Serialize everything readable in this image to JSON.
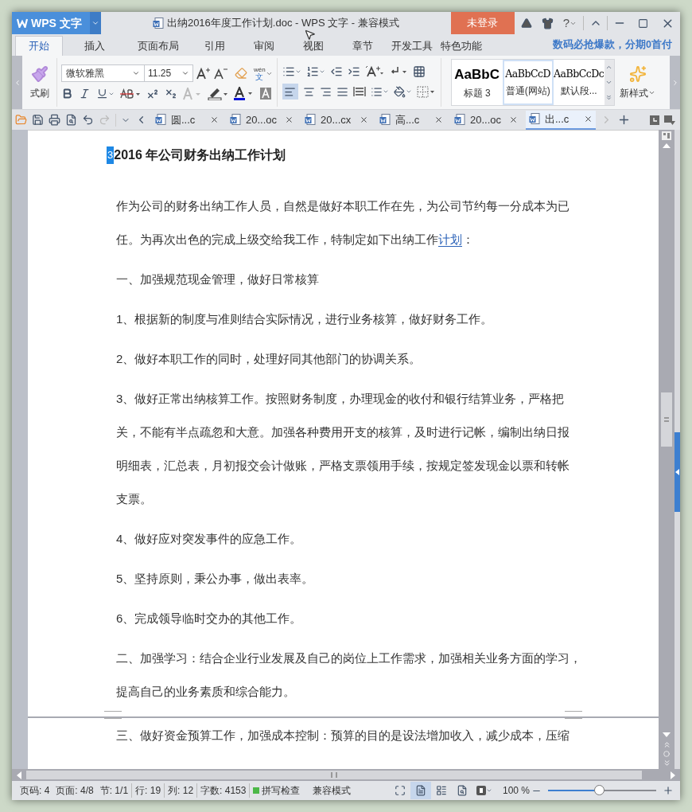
{
  "title_bar": {
    "app_button": "WPS 文字",
    "doc_title": "出纳2016年度工作计划.doc - WPS 文字 - 兼容模式",
    "login": "未登录",
    "help": "?"
  },
  "ribbon_tabs": [
    {
      "label": "开始",
      "selected": true
    },
    {
      "label": "插入",
      "selected": false
    },
    {
      "label": "页面布局",
      "selected": false
    },
    {
      "label": "引用",
      "selected": false
    },
    {
      "label": "审阅",
      "selected": false
    },
    {
      "label": "视图",
      "selected": false
    },
    {
      "label": "章节",
      "selected": false
    },
    {
      "label": "开发工具",
      "selected": false
    },
    {
      "label": "特色功能",
      "selected": false
    }
  ],
  "promo": "数码必抢爆款，分期0首付",
  "ribbon": {
    "format_painter": "式刷",
    "font": "微软雅黑",
    "font_size": "11.25",
    "pinyin": "wén",
    "pinyin_char": "文",
    "styles": [
      {
        "preview": "AaBbC",
        "name": "标题 3",
        "selected": false,
        "kind": "heading"
      },
      {
        "preview": "AaBbCcD",
        "name": "普通(网站)",
        "selected": true,
        "kind": "normal"
      },
      {
        "preview": "AaBbCcDc",
        "name": "默认段...",
        "selected": false,
        "kind": "normal"
      }
    ],
    "new_style": "新样式"
  },
  "doc_tabs": [
    {
      "label": "圆...c",
      "selected": false
    },
    {
      "label": "20...oc",
      "selected": false
    },
    {
      "label": "20...cx",
      "selected": false
    },
    {
      "label": "高...c",
      "selected": false
    },
    {
      "label": "20...oc",
      "selected": false
    },
    {
      "label": "出...c",
      "selected": true
    }
  ],
  "document": {
    "cursor_mark": "3",
    "heading": "2016 年公司财务出纳工作计划",
    "paragraphs": [
      {
        "lines": [
          "作为公司的财务出纳工作人员，自然是做好本职工作在先，为公司节约每一分成本为已",
          "任。为再次出色的完成上级交给我工作，特制定如下出纳工作"
        ],
        "link": "计划",
        "tail": "："
      },
      {
        "lines": [
          "一、加强规范现金管理，做好日常核算"
        ]
      },
      {
        "lines": [
          "1、根据新的制度与准则结合实际情况，进行业务核算，做好财务工作。"
        ]
      },
      {
        "lines": [
          "2、做好本职工作的同时，处理好同其他部门的协调关系。"
        ]
      },
      {
        "lines": [
          "3、做好正常出纳核算工作。按照财务制度，办理现金的收付和银行结算业务，严格把",
          "关，不能有半点疏忽和大意。加强各种费用开支的核算，及时进行记帐，编制出纳日报",
          "明细表，汇总表，月初报交会计做账，严格支票领用手续，按规定签发现金以票和转帐",
          "支票。"
        ]
      },
      {
        "lines": [
          "4、做好应对突发事件的应急工作。"
        ]
      },
      {
        "lines": [
          "5、坚持原则，秉公办事，做出表率。"
        ]
      },
      {
        "lines": [
          "6、完成领导临时交办的其他工作。"
        ]
      },
      {
        "lines": [
          "二、加强学习：结合企业行业发展及自己的岗位上工作需求，加强相关业务方面的学习，",
          "提高自己的业务素质和综合能力。"
        ]
      }
    ],
    "next_page_paragraph": "三、做好资金预算工作，加强成本控制：预算的目的是设法增加收入，减少成本，压缩"
  },
  "status_bar": {
    "items": [
      "页码: 4",
      "页面: 4/8",
      "节: 1/1",
      "行: 19",
      "列: 12",
      "字数: 4153"
    ],
    "spell_check": "拼写检查",
    "mode": "兼容模式",
    "zoom": "100 %",
    "zoom_slider": {
      "level": 0.47
    }
  }
}
